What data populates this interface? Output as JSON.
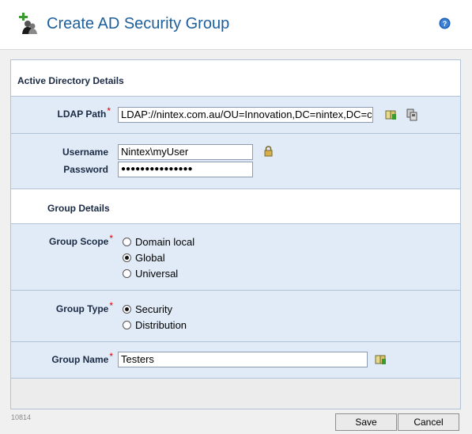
{
  "header": {
    "title": "Create AD Security Group",
    "app_icon": "security-group-add-icon",
    "help_icon": "help-icon"
  },
  "sections": {
    "active_directory": "Active Directory Details",
    "group": "Group Details"
  },
  "ldap": {
    "label": "LDAP Path",
    "required_mark": "*",
    "value": "LDAP://nintex.com.au/OU=Innovation,DC=nintex,DC=c",
    "lookup_icon": "insert-reference-icon",
    "browse_icon": "ldap-browse-icon"
  },
  "credentials": {
    "username_label": "Username",
    "username_value": "Nintex\\myUser",
    "password_label": "Password",
    "password_value": "●●●●●●●●●●●●●●●",
    "lock_icon": "lock-icon"
  },
  "group_scope": {
    "label": "Group Scope",
    "required_mark": "*",
    "options": [
      "Domain local",
      "Global",
      "Universal"
    ],
    "selected": "Global"
  },
  "group_type": {
    "label": "Group Type",
    "required_mark": "*",
    "options": [
      "Security",
      "Distribution"
    ],
    "selected": "Security"
  },
  "group_name": {
    "label": "Group Name",
    "required_mark": "*",
    "value": "Testers",
    "lookup_icon": "insert-reference-icon"
  },
  "footer": {
    "id": "10814",
    "save_label": "Save",
    "cancel_label": "Cancel"
  },
  "colors": {
    "title": "#1c5f9c",
    "row_background": "#e1ebf7",
    "required": "#dd0000"
  }
}
